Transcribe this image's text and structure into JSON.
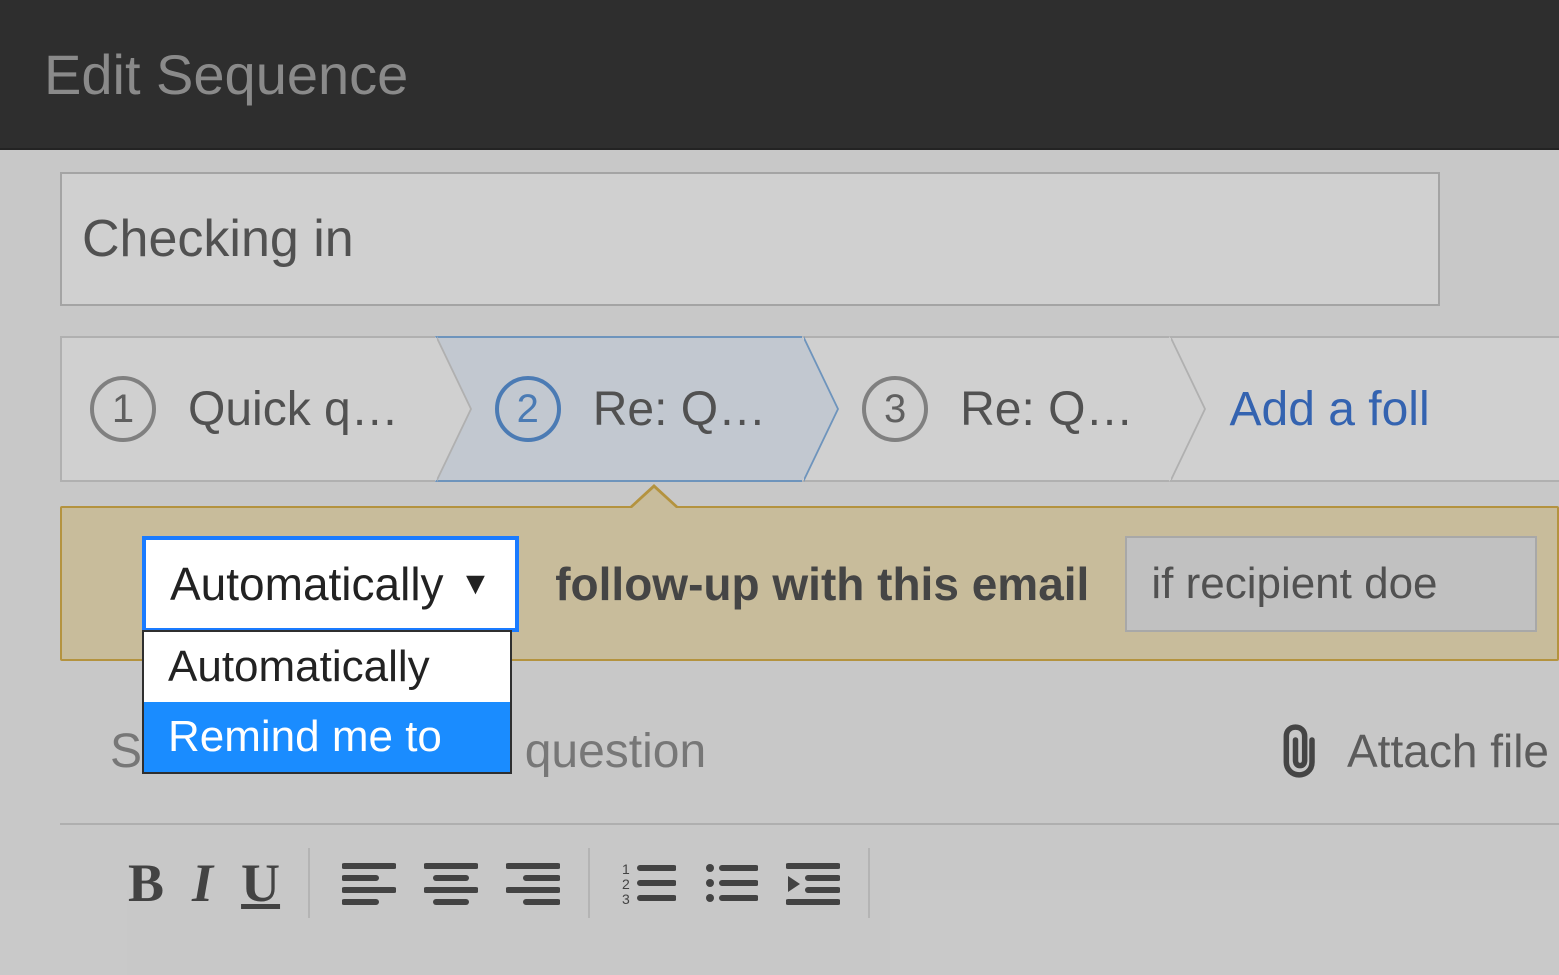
{
  "header": {
    "title": "Edit Sequence"
  },
  "sequence_name": "Checking in",
  "steps": [
    {
      "num": "1",
      "label": "Quick q…"
    },
    {
      "num": "2",
      "label": "Re: Q…"
    },
    {
      "num": "3",
      "label": "Re: Q…"
    }
  ],
  "add_followup_label": "Add a foll",
  "trigger": {
    "selected": "Automatically",
    "options": [
      "Automatically",
      "Remind me to"
    ],
    "followup_text": "follow-up with this email",
    "condition_text": "if recipient doe"
  },
  "subject": {
    "label_prefix": "Su",
    "value_fragment": "question",
    "attach_label": "Attach file"
  }
}
